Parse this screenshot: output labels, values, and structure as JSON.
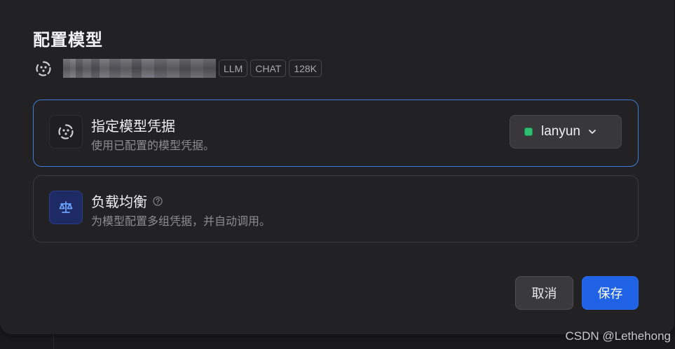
{
  "dialog": {
    "title": "配置模型",
    "model": {
      "name": "",
      "icon": "model-provider-icon",
      "tags": [
        "LLM",
        "CHAT",
        "128K"
      ]
    },
    "options": [
      {
        "title": "指定模型凭据",
        "description": "使用已配置的模型凭据。",
        "icon": "model-provider-icon",
        "selected": true,
        "credential": {
          "value": "lanyun",
          "status_color": "#2fbf71"
        }
      },
      {
        "title": "负载均衡",
        "description": "为模型配置多组凭据，并自动调用。",
        "icon": "scale-icon",
        "help_icon": "help-circle-icon",
        "selected": false
      }
    ],
    "buttons": {
      "cancel": "取消",
      "save": "保存"
    }
  },
  "colors": {
    "accent": "#1f62e6",
    "selected_border": "#3c7dd8"
  },
  "watermark": "CSDN @Lethehong"
}
